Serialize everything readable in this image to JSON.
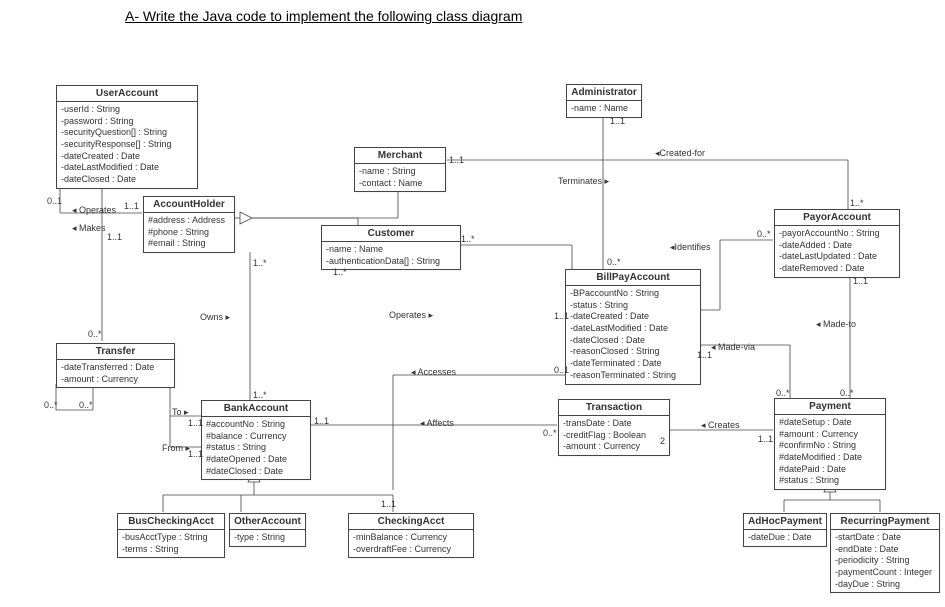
{
  "title_prefix": "A-  ",
  "title_main": "Write the Java code to implement the following class diagram",
  "classes": {
    "UserAccount": {
      "name": "UserAccount",
      "attrs": [
        "-userId : String",
        "-password : String",
        "-securityQuestion[] : String",
        "-securityResponse[] : String",
        "-dateCreated : Date",
        "-dateLastModified : Date",
        "-dateClosed : Date"
      ]
    },
    "Administrator": {
      "name": "Administrator",
      "attrs": [
        "-name : Name"
      ]
    },
    "Merchant": {
      "name": "Merchant",
      "attrs": [
        "-name : String",
        "-contact : Name"
      ]
    },
    "AccountHolder": {
      "name": "AccountHolder",
      "attrs": [
        "#address : Address",
        "#phone : String",
        "#email : String"
      ]
    },
    "Customer": {
      "name": "Customer",
      "attrs": [
        "-name : Name",
        "-authenticationData[] : String"
      ]
    },
    "PayorAccount": {
      "name": "PayorAccount",
      "attrs": [
        "-payorAccountNo : String",
        "-dateAdded : Date",
        "-dateLastUpdated : Date",
        "-dateRemoved : Date"
      ]
    },
    "BillPayAccount": {
      "name": "BillPayAccount",
      "attrs": [
        "-BPaccountNo : String",
        "-status : String",
        "-dateCreated : Date",
        "-dateLastModified : Date",
        "-dateClosed : Date",
        "-reasonClosed : String",
        "-dateTerminated : Date",
        "-reasonTerminated : String"
      ]
    },
    "Transfer": {
      "name": "Transfer",
      "attrs": [
        "-dateTransferred : Date",
        "-amount : Currency"
      ]
    },
    "BankAccount": {
      "name": "BankAccount",
      "attrs": [
        "#accountNo : String",
        "#balance : Currency",
        "#status : String",
        "#dateOpened : Date",
        "#dateClosed : Date"
      ]
    },
    "Transaction": {
      "name": "Transaction",
      "attrs": [
        "-transDate : Date",
        "-creditFlag : Boolean",
        "-amount : Currency"
      ]
    },
    "Payment": {
      "name": "Payment",
      "attrs": [
        "#dateSetup : Date",
        "#amount : Currency",
        "#confirmNo : String",
        "#dateModified : Date",
        "#datePaid : Date",
        "#status : String"
      ]
    },
    "BusCheckingAcct": {
      "name": "BusCheckingAcct",
      "attrs": [
        "-busAcctType : String",
        "-terms : String"
      ]
    },
    "OtherAccount": {
      "name": "OtherAccount",
      "attrs": [
        "-type : String"
      ]
    },
    "CheckingAcct": {
      "name": "CheckingAcct",
      "attrs": [
        "-minBalance : Currency",
        "-overdraftFee : Currency"
      ]
    },
    "AdHocPayment": {
      "name": "AdHocPayment",
      "attrs": [
        "-dateDue : Date"
      ]
    },
    "RecurringPayment": {
      "name": "RecurringPayment",
      "attrs": [
        "-startDate : Date",
        "-endDate : Date",
        "-periodicity : String",
        "-paymentCount : Integer",
        "-dayDue : String"
      ]
    }
  },
  "assoc": {
    "operates1": "◂ Operates",
    "makes": "◂ Makes",
    "owns": "Owns ▸",
    "operates2": "Operates ▸",
    "accesses": "◂ Accesses",
    "affects": "◂ Affects",
    "to": "To ▸",
    "from": "From ▸",
    "terminates": "Terminates ▸",
    "createdFor": "◂Created-for",
    "identifies": "◂Identifies",
    "madeVia": "◂ Made-via",
    "madeTo": "◂ Made-to",
    "creates": "◂ Creates"
  },
  "mult": {
    "m01": "0..1",
    "m11": "1..1",
    "m1s": "1..*",
    "m0s": "0..*",
    "m2": "2"
  },
  "chart_data": {
    "type": "table",
    "description": "UML class diagram",
    "classes": [
      {
        "name": "UserAccount",
        "attributes": [
          "userId:String",
          "password:String",
          "securityQuestion[]:String",
          "securityResponse[]:String",
          "dateCreated:Date",
          "dateLastModified:Date",
          "dateClosed:Date"
        ]
      },
      {
        "name": "Administrator",
        "attributes": [
          "name:Name"
        ]
      },
      {
        "name": "Merchant",
        "attributes": [
          "name:String",
          "contact:Name"
        ]
      },
      {
        "name": "AccountHolder",
        "attributes": [
          "address:Address",
          "phone:String",
          "email:String"
        ]
      },
      {
        "name": "Customer",
        "attributes": [
          "name:Name",
          "authenticationData[]:String"
        ]
      },
      {
        "name": "PayorAccount",
        "attributes": [
          "payorAccountNo:String",
          "dateAdded:Date",
          "dateLastUpdated:Date",
          "dateRemoved:Date"
        ]
      },
      {
        "name": "BillPayAccount",
        "attributes": [
          "BPaccountNo:String",
          "status:String",
          "dateCreated:Date",
          "dateLastModified:Date",
          "dateClosed:Date",
          "reasonClosed:String",
          "dateTerminated:Date",
          "reasonTerminated:String"
        ]
      },
      {
        "name": "Transfer",
        "attributes": [
          "dateTransferred:Date",
          "amount:Currency"
        ]
      },
      {
        "name": "BankAccount",
        "attributes": [
          "accountNo:String",
          "balance:Currency",
          "status:String",
          "dateOpened:Date",
          "dateClosed:Date"
        ]
      },
      {
        "name": "Transaction",
        "attributes": [
          "transDate:Date",
          "creditFlag:Boolean",
          "amount:Currency"
        ]
      },
      {
        "name": "Payment",
        "attributes": [
          "dateSetup:Date",
          "amount:Currency",
          "confirmNo:String",
          "dateModified:Date",
          "datePaid:Date",
          "status:String"
        ]
      },
      {
        "name": "BusCheckingAcct",
        "attributes": [
          "busAcctType:String",
          "terms:String"
        ]
      },
      {
        "name": "OtherAccount",
        "attributes": [
          "type:String"
        ]
      },
      {
        "name": "CheckingAcct",
        "attributes": [
          "minBalance:Currency",
          "overdraftFee:Currency"
        ]
      },
      {
        "name": "AdHocPayment",
        "attributes": [
          "dateDue:Date"
        ]
      },
      {
        "name": "RecurringPayment",
        "attributes": [
          "startDate:Date",
          "endDate:Date",
          "periodicity:String",
          "paymentCount:Integer",
          "dayDue:String"
        ]
      }
    ],
    "relationships": [
      {
        "type": "generalization",
        "parent": "AccountHolder",
        "children": [
          "Merchant",
          "Customer"
        ]
      },
      {
        "type": "generalization",
        "parent": "BankAccount",
        "children": [
          "BusCheckingAcct",
          "OtherAccount",
          "CheckingAcct"
        ]
      },
      {
        "type": "generalization",
        "parent": "Payment",
        "children": [
          "AdHocPayment",
          "RecurringPayment"
        ]
      },
      {
        "type": "association",
        "name": "Operates",
        "from": "UserAccount",
        "fromMult": "0..1",
        "to": "AccountHolder",
        "toMult": "1..1"
      },
      {
        "type": "association",
        "name": "Makes",
        "from": "UserAccount",
        "fromMult": "1..1",
        "to": "Transfer",
        "toMult": "0..*"
      },
      {
        "type": "association",
        "name": "Owns",
        "from": "AccountHolder",
        "fromMult": "1..*",
        "to": "BankAccount",
        "toMult": "1..*"
      },
      {
        "type": "association",
        "name": "To",
        "from": "Transfer",
        "fromMult": "0..*",
        "to": "BankAccount",
        "toMult": "1..1"
      },
      {
        "type": "association",
        "name": "From",
        "from": "Transfer",
        "fromMult": "0..*",
        "to": "BankAccount",
        "toMult": "1..1"
      },
      {
        "type": "association",
        "name": "Operates",
        "from": "Customer",
        "fromMult": "1..*",
        "to": "BillPayAccount",
        "toMult": "1..1"
      },
      {
        "type": "association",
        "name": "Accesses",
        "from": "BillPayAccount",
        "fromMult": "0..1",
        "to": "CheckingAcct",
        "toMult": "1..1"
      },
      {
        "type": "association",
        "name": "Affects",
        "from": "Transaction",
        "fromMult": "0..*",
        "to": "BankAccount",
        "toMult": "2"
      },
      {
        "type": "association",
        "name": "Terminates",
        "from": "Administrator",
        "fromMult": "1..1",
        "to": "BillPayAccount",
        "toMult": "0..*"
      },
      {
        "type": "association",
        "name": "Created-for",
        "from": "Merchant",
        "fromMult": "1..1",
        "to": "PayorAccount",
        "toMult": "1..*"
      },
      {
        "type": "association",
        "name": "Identifies",
        "from": "BillPayAccount",
        "fromMult": "1..1",
        "to": "PayorAccount",
        "toMult": "0..*"
      },
      {
        "type": "association",
        "name": "Made-via",
        "from": "BillPayAccount",
        "fromMult": "1..1",
        "to": "Payment",
        "toMult": "0..*"
      },
      {
        "type": "association",
        "name": "Made-to",
        "from": "PayorAccount",
        "fromMult": "1..1",
        "to": "Payment",
        "toMult": "0..*"
      },
      {
        "type": "association",
        "name": "Creates",
        "from": "Transaction",
        "fromMult": "1..1",
        "to": "Payment",
        "toMult": "1..1"
      }
    ]
  }
}
